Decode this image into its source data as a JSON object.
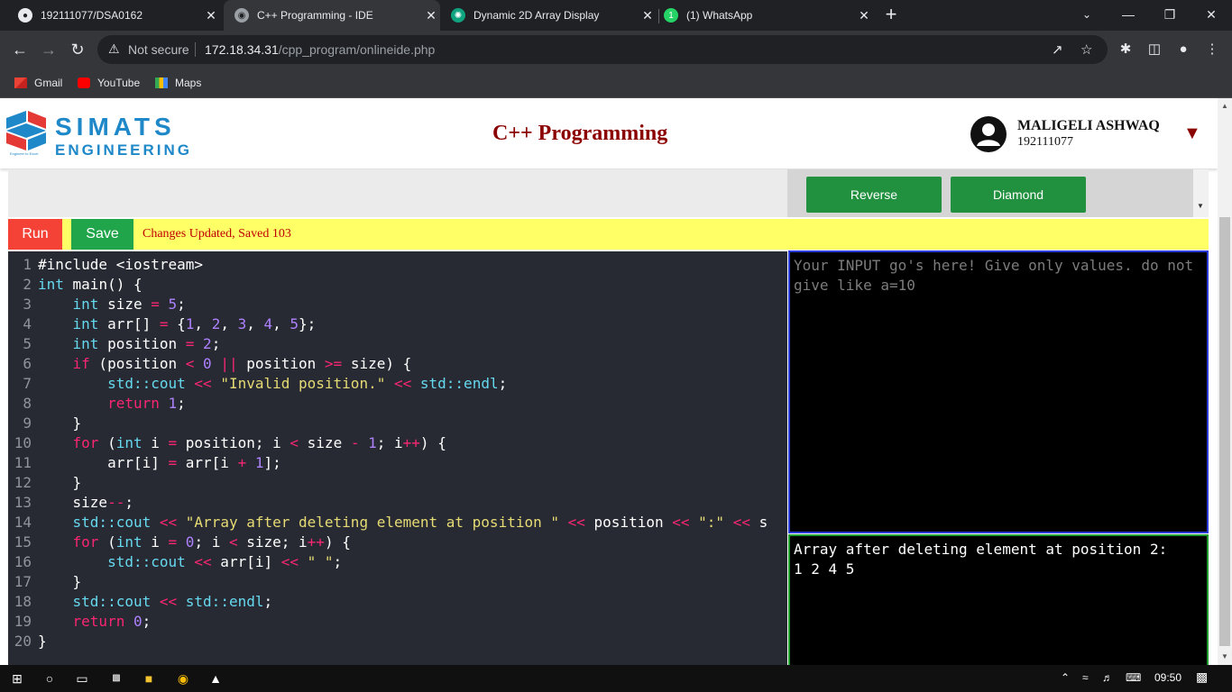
{
  "browser": {
    "tabs": [
      {
        "title": "192111077/DSA0162",
        "icon": "github-icon",
        "active": false
      },
      {
        "title": "C++ Programming - IDE",
        "icon": "globe-icon",
        "active": true
      },
      {
        "title": "Dynamic 2D Array Display",
        "icon": "chatgpt-icon",
        "active": false
      },
      {
        "title": "(1) WhatsApp",
        "icon": "whatsapp-icon",
        "badge": "1",
        "active": false
      }
    ],
    "security_label": "Not secure",
    "url_host": "172.18.34.31",
    "url_path": "/cpp_program/onlineide.php",
    "bookmarks": [
      {
        "label": "Gmail",
        "icon": "gmail-icon"
      },
      {
        "label": "YouTube",
        "icon": "youtube-icon"
      },
      {
        "label": "Maps",
        "icon": "maps-icon"
      }
    ]
  },
  "header": {
    "logo_line1": "SIMATS",
    "logo_line2": "ENGINEERING",
    "logo_tagline": "Engineer to Excel",
    "title": "C++ Programming",
    "user_name": "MALIGELI ASHWAQ",
    "user_id": "192111077"
  },
  "snippets": {
    "buttons": [
      "Reverse",
      "Diamond"
    ]
  },
  "actions": {
    "run_label": "Run",
    "save_label": "Save",
    "status_text": "Changes Updated, Saved 103"
  },
  "editor": {
    "lines": [
      {
        "n": "1",
        "code": "#include <iostream>"
      },
      {
        "n": "2",
        "code": "int main() {"
      },
      {
        "n": "3",
        "code": "    int size = 5;"
      },
      {
        "n": "4",
        "code": "    int arr[] = {1, 2, 3, 4, 5};"
      },
      {
        "n": "5",
        "code": "    int position = 2;"
      },
      {
        "n": "6",
        "code": "    if (position < 0 || position >= size) {"
      },
      {
        "n": "7",
        "code": "        std::cout << \"Invalid position.\" << std::endl;"
      },
      {
        "n": "8",
        "code": "        return 1;"
      },
      {
        "n": "9",
        "code": "    }"
      },
      {
        "n": "10",
        "code": "    for (int i = position; i < size - 1; i++) {"
      },
      {
        "n": "11",
        "code": "        arr[i] = arr[i + 1];"
      },
      {
        "n": "12",
        "code": "    }"
      },
      {
        "n": "13",
        "code": "    size--;"
      },
      {
        "n": "14",
        "code": "    std::cout << \"Array after deleting element at position \" << position << \":\" << s"
      },
      {
        "n": "15",
        "code": "    for (int i = 0; i < size; i++) {"
      },
      {
        "n": "16",
        "code": "        std::cout << arr[i] << \" \";"
      },
      {
        "n": "17",
        "code": "    }"
      },
      {
        "n": "18",
        "code": "    std::cout << std::endl;"
      },
      {
        "n": "19",
        "code": "    return 0;"
      },
      {
        "n": "20",
        "code": "}"
      }
    ]
  },
  "input": {
    "placeholder": "Your INPUT go's here! Give only values. do not give like a=10"
  },
  "output": {
    "text": "Array after deleting element at position 2:\n1 2 4 5"
  },
  "taskbar": {
    "time": "09:50"
  },
  "colors": {
    "keyword": "#f92672",
    "type": "#66d9ef",
    "string": "#e6db74",
    "number": "#ae81ff",
    "accent_green": "#21913f",
    "run_red": "#f44336",
    "title_red": "#8b0000"
  }
}
